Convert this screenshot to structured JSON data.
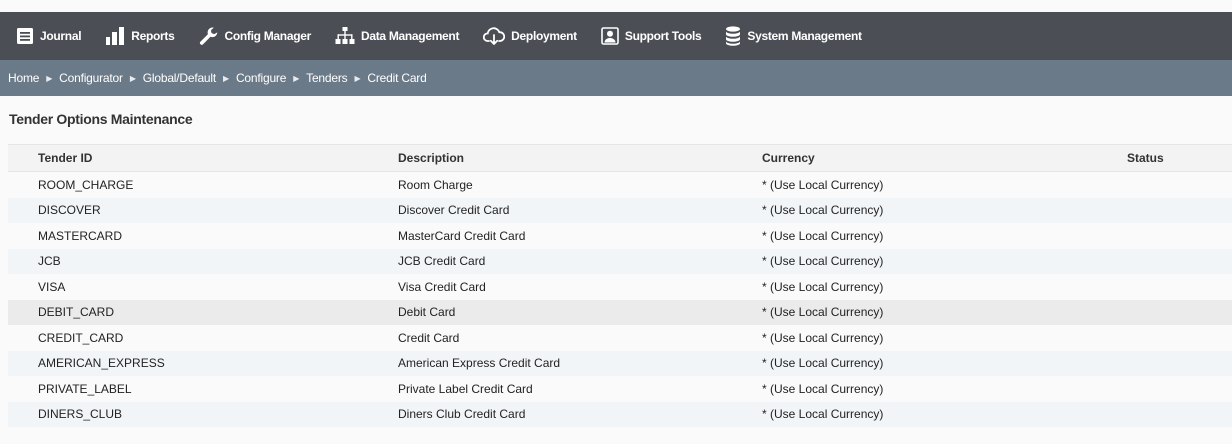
{
  "nav": {
    "items": [
      {
        "label": "Journal",
        "icon": "journal-icon"
      },
      {
        "label": "Reports",
        "icon": "bar-chart-icon"
      },
      {
        "label": "Config Manager",
        "icon": "wrench-icon"
      },
      {
        "label": "Data Management",
        "icon": "hierarchy-icon"
      },
      {
        "label": "Deployment",
        "icon": "cloud-download-icon"
      },
      {
        "label": "Support Tools",
        "icon": "support-user-icon"
      },
      {
        "label": "System Management",
        "icon": "database-icon"
      }
    ]
  },
  "breadcrumb": [
    "Home",
    "Configurator",
    "Global/Default",
    "Configure",
    "Tenders",
    "Credit Card"
  ],
  "page": {
    "title": "Tender Options Maintenance"
  },
  "table": {
    "columns": [
      "Tender ID",
      "Description",
      "Currency",
      "Status"
    ],
    "rows": [
      {
        "id": "ROOM_CHARGE",
        "description": "Room Charge",
        "currency": "* (Use Local Currency)",
        "status": ""
      },
      {
        "id": "DISCOVER",
        "description": "Discover Credit Card",
        "currency": "* (Use Local Currency)",
        "status": ""
      },
      {
        "id": "MASTERCARD",
        "description": "MasterCard Credit Card",
        "currency": "* (Use Local Currency)",
        "status": ""
      },
      {
        "id": "JCB",
        "description": "JCB Credit Card",
        "currency": "* (Use Local Currency)",
        "status": ""
      },
      {
        "id": "VISA",
        "description": "Visa Credit Card",
        "currency": "* (Use Local Currency)",
        "status": ""
      },
      {
        "id": "DEBIT_CARD",
        "description": "Debit Card",
        "currency": "* (Use Local Currency)",
        "status": ""
      },
      {
        "id": "CREDIT_CARD",
        "description": "Credit Card",
        "currency": "* (Use Local Currency)",
        "status": ""
      },
      {
        "id": "AMERICAN_EXPRESS",
        "description": "American Express Credit Card",
        "currency": "* (Use Local Currency)",
        "status": ""
      },
      {
        "id": "PRIVATE_LABEL",
        "description": "Private Label Credit Card",
        "currency": "* (Use Local Currency)",
        "status": ""
      },
      {
        "id": "DINERS_CLUB",
        "description": "Diners Club Credit Card",
        "currency": "* (Use Local Currency)",
        "status": ""
      }
    ]
  },
  "colors": {
    "topbar": "#4b4f55",
    "breadcrumb_bar": "#6b7a88",
    "row_alt": "#f2f5f8",
    "row_highlight": "#ebebeb"
  }
}
